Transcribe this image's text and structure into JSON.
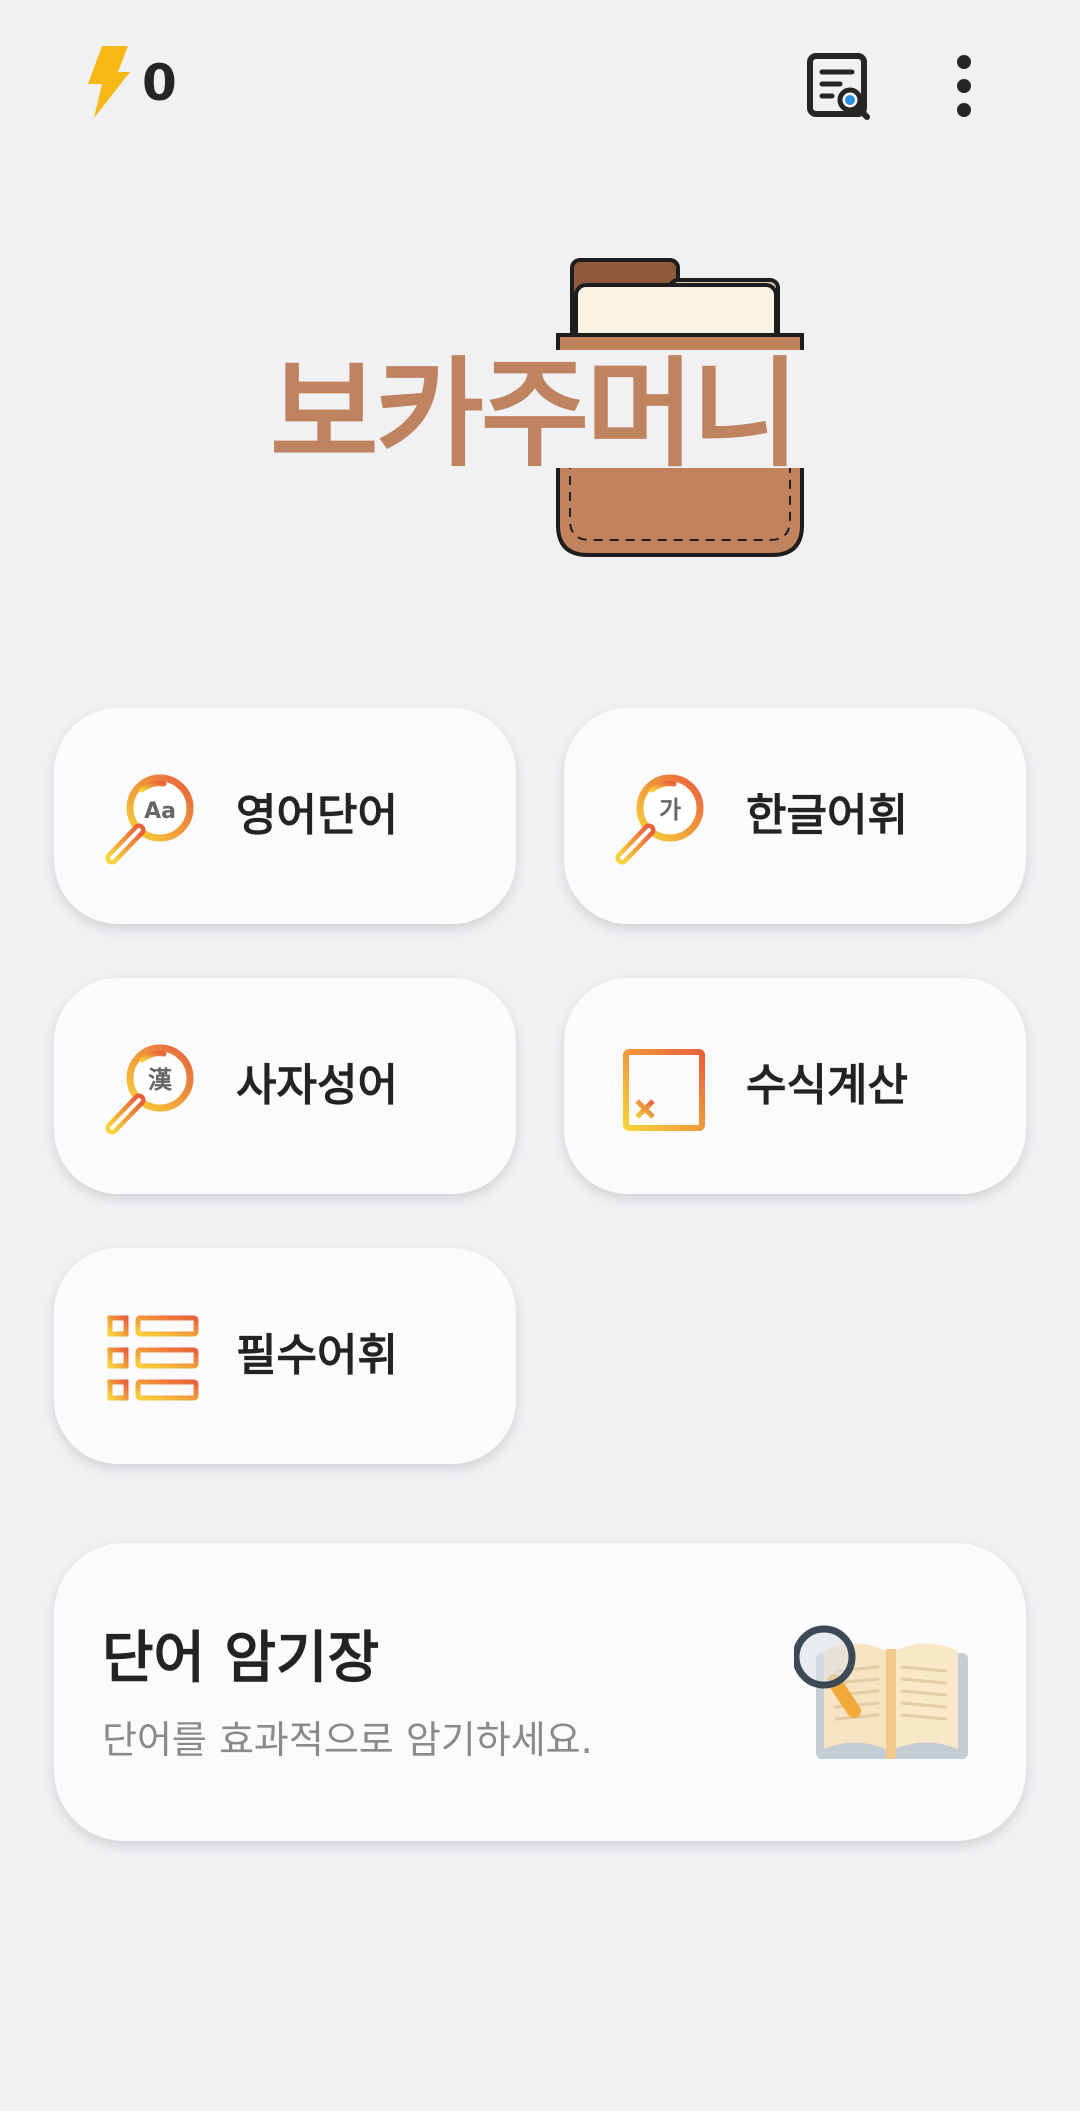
{
  "status": {
    "points": "0",
    "bolt_color": "#f6b814"
  },
  "header_icons": {
    "search_document": "document-search-icon",
    "more": "more-vert-icon"
  },
  "logo": {
    "text": "보카주머니",
    "color": "#c08360"
  },
  "categories": [
    {
      "label": "영어단어",
      "icon": "magnifier-icon",
      "badge": "Aa"
    },
    {
      "label": "한글어휘",
      "icon": "magnifier-icon",
      "badge": "가"
    },
    {
      "label": "사자성어",
      "icon": "magnifier-icon",
      "badge": "漢"
    },
    {
      "label": "수식계산",
      "icon": "calculator-icon"
    },
    {
      "label": "필수어휘",
      "icon": "list-icon"
    }
  ],
  "memo_card": {
    "title": "단어 암기장",
    "subtitle": "단어를 효과적으로 암기하세요.",
    "icon": "book-magnifier-icon"
  },
  "colors": {
    "background": "#f1f1f4",
    "card": "#fbfbfd",
    "icon_gradient_start": "#f7d23a",
    "icon_gradient_end": "#e8603c"
  }
}
